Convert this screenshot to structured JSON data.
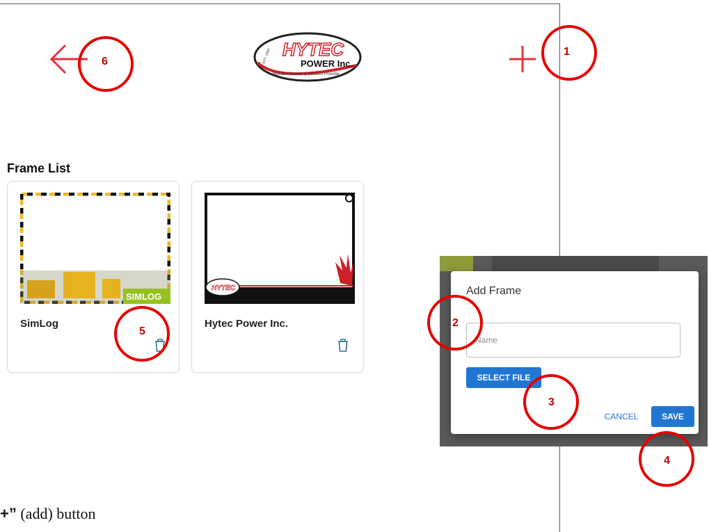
{
  "header": {
    "logo_brand": "HYTEC",
    "logo_sub": "POWER Inc.",
    "logo_tagline": "Reliable Partner & Solution Provider",
    "logo_est": "EST. 1984"
  },
  "frame_list": {
    "title": "Frame List",
    "cards": [
      {
        "name": "SimLog",
        "thumb_text": "SIMLOG"
      },
      {
        "name": "Hytec Power Inc.",
        "thumb_text": "HYTEC"
      }
    ]
  },
  "dialog": {
    "title": "Add Frame",
    "name_placeholder": "Name",
    "select_file_label": "SELECT FILE",
    "cancel_label": "CANCEL",
    "save_label": "SAVE"
  },
  "callouts": [
    "1",
    "2",
    "3",
    "4",
    "5",
    "6"
  ],
  "caption": {
    "prefix": "+”",
    "text": " (add) button"
  },
  "colors": {
    "accent_red": "#e5323b",
    "callout_red": "#e60000",
    "primary_blue": "#2176d2"
  }
}
